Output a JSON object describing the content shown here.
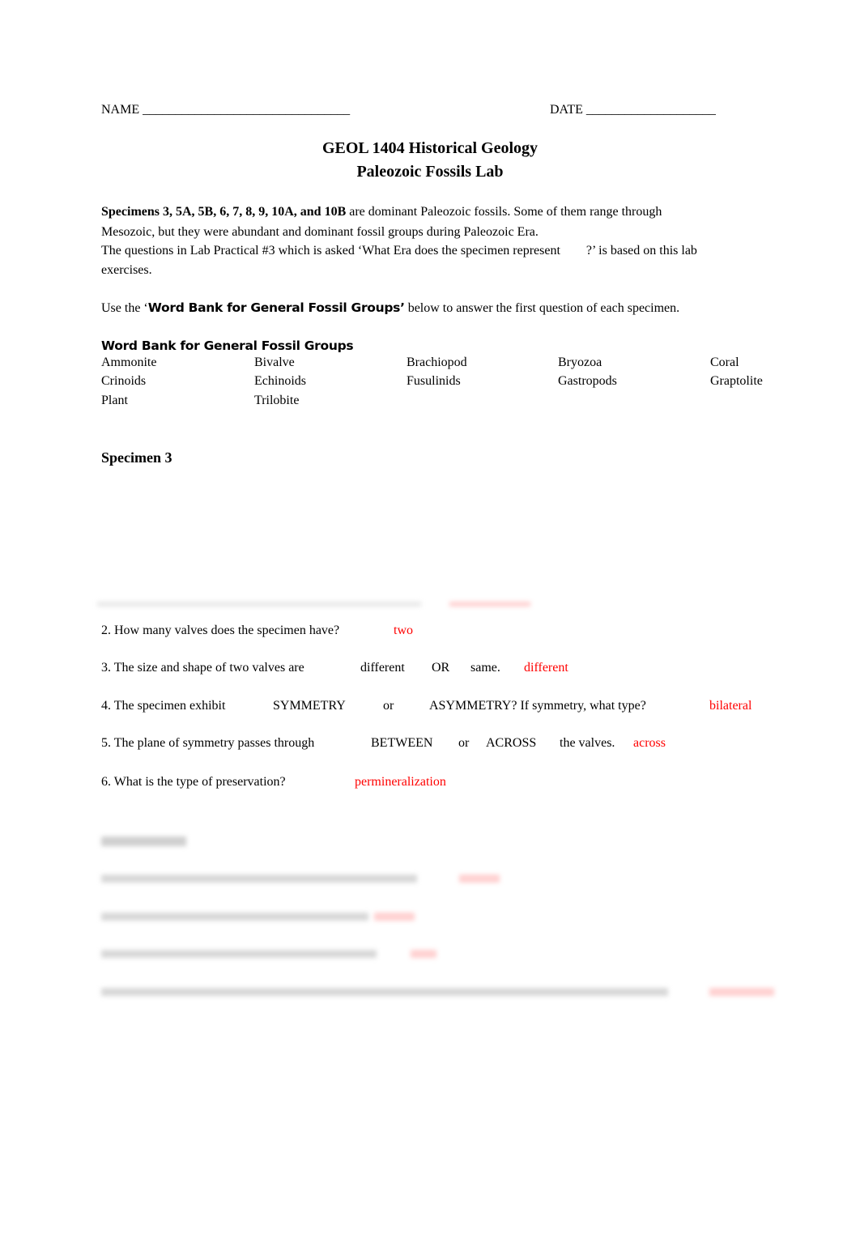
{
  "header": {
    "name_label": "NAME",
    "name_blank": "________________________________",
    "date_label": "DATE",
    "date_blank": "____________________"
  },
  "title": {
    "line1": "GEOL 1404 Historical Geology",
    "line2": "Paleozoic Fossils Lab"
  },
  "intro": {
    "bold_specimens": "Specimens 3, 5A, 5B, 6, 7, 8, 9, 10A, and 10B",
    "line1_rest": " are dominant Paleozoic fossils. Some of them range through",
    "line2": "Mesozoic, but they were abundant and dominant fossil groups during Paleozoic Era.",
    "line3": "The questions in Lab Practical #3 which is asked ‘What Era does the specimen represent        ?’ is based on this lab",
    "line4": "exercises."
  },
  "instruction": {
    "prefix": "Use the ‘",
    "bold": "Word Bank for General Fossil Groups’",
    "suffix": " below to answer the first question of each specimen."
  },
  "word_bank": {
    "heading": "Word Bank for General Fossil Groups",
    "rows": [
      [
        "Ammonite",
        "Bivalve",
        "Brachiopod",
        "Bryozoa",
        "Coral"
      ],
      [
        "Crinoids",
        "Echinoids",
        "Fusulinids",
        "Gastropods",
        "Graptolite"
      ],
      [
        "Plant",
        "Trilobite"
      ]
    ]
  },
  "specimen3": {
    "heading": "Specimen 3",
    "questions": [
      {
        "text": "2. How many valves does the specimen have?",
        "answer": "two"
      },
      {
        "text": "3. The size and shape of two valves are",
        "options": [
          "different",
          "OR",
          "same."
        ],
        "answer": "different"
      },
      {
        "text": "4. The specimen exhibit",
        "options": [
          "SYMMETRY",
          "or",
          "ASYMMETRY?  If symmetry, what type?"
        ],
        "answer": "bilateral"
      },
      {
        "text": "5. The plane of symmetry passes through",
        "options": [
          "BETWEEN",
          "or",
          "ACROSS",
          "the valves."
        ],
        "answer": "across"
      },
      {
        "text": "6. What is the type of preservation?",
        "answer": "permineralization"
      }
    ]
  },
  "colors": {
    "answer_red": "#ff0000"
  }
}
